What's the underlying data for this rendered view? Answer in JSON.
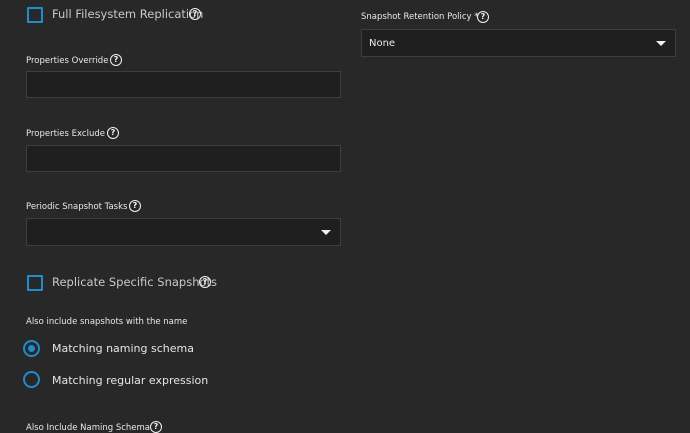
{
  "left": {
    "full_fs_replication": {
      "label": "Full Filesystem Replication",
      "checked": false
    },
    "properties_override": {
      "label": "Properties Override",
      "value": ""
    },
    "properties_exclude": {
      "label": "Properties Exclude",
      "value": ""
    },
    "periodic_snapshot_tasks": {
      "label": "Periodic Snapshot Tasks",
      "value": ""
    },
    "replicate_specific_snapshots": {
      "label": "Replicate Specific Snapshots",
      "checked": false
    },
    "also_include_label": "Also include snapshots with the name",
    "radio_options": [
      {
        "label": "Matching naming schema",
        "selected": true
      },
      {
        "label": "Matching regular expression",
        "selected": false
      }
    ],
    "also_include_naming_schema_label": "Also Include Naming Schema"
  },
  "right": {
    "snapshot_retention_policy": {
      "label": "Snapshot Retention Policy *",
      "value": "None"
    }
  },
  "icons": {
    "help": "?",
    "help_icon_name": "help-circle-icon",
    "caret_icon_name": "caret-down-icon"
  },
  "colors": {
    "background": "#282828",
    "field_background": "#1f1f1f",
    "accent": "#1f8ccd",
    "text": "#e6e6e6"
  }
}
